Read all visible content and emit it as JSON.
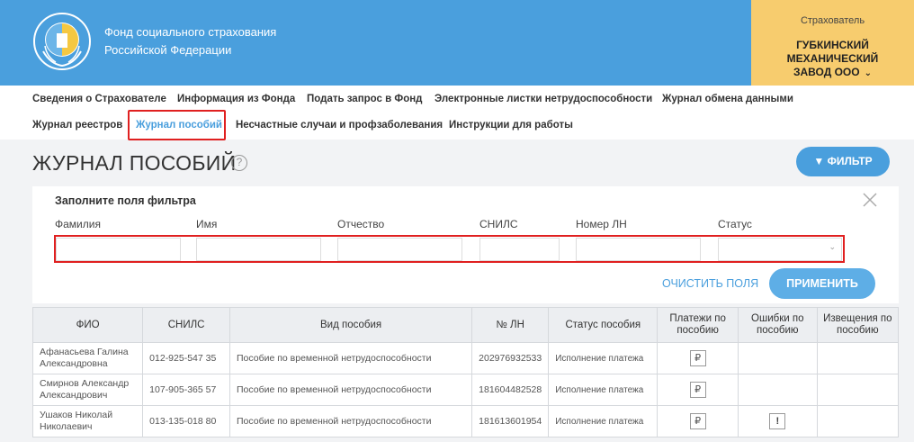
{
  "header": {
    "fund_line1": "Фонд социального страхования",
    "fund_line2": "Российской Федерации",
    "insurer_label": "Страхователь",
    "insurer_line1": "ГУБКИНСКИЙ",
    "insurer_line2": "МЕХАНИЧЕСКИЙ",
    "insurer_line3": "ЗАВОД ООО",
    "brand_color": "#4a9fdd",
    "insurer_color": "#f7cc6e"
  },
  "nav": {
    "items": [
      "Сведения о Страхователе",
      "Информация из Фонда",
      "Подать запрос в Фонд",
      "Электронные листки нетрудоспособности",
      "Журнал обмена данными",
      "Журнал реестров",
      "Журнал пособий",
      "Несчастные случаи и профзаболевания",
      "Инструкции для работы"
    ],
    "active": "Журнал пособий"
  },
  "page": {
    "title": "ЖУРНАЛ ПОСОБИЙ",
    "help": "?",
    "filter_button": "ФИЛЬТР"
  },
  "filter": {
    "heading": "Заполните поля фильтра",
    "labels": [
      "Фамилия",
      "Имя",
      "Отчество",
      "СНИЛС",
      "Номер ЛН",
      "Статус"
    ],
    "clear_label": "ОЧИСТИТЬ ПОЛЯ",
    "apply_label": "ПРИМЕНИТЬ"
  },
  "table": {
    "columns": [
      "ФИО",
      "СНИЛС",
      "Вид пособия",
      "№ ЛН",
      "Статус пособия",
      "Платежи по пособию",
      "Ошибки по пособию",
      "Извещения по пособию"
    ],
    "rows": [
      {
        "name": "Афанасьева Галина Александровна",
        "snils": "012-925-547 35",
        "type": "Пособие по временной нетрудоспособности",
        "ln": "202976932533",
        "status": "Исполнение платежа",
        "payments": "₽",
        "errors": "",
        "notices": ""
      },
      {
        "name": "Смирнов Александр Александрович",
        "snils": "107-905-365 57",
        "type": "Пособие по временной нетрудоспособности",
        "ln": "181604482528",
        "status": "Исполнение платежа",
        "payments": "₽",
        "errors": "",
        "notices": ""
      },
      {
        "name": "Ушаков Николай Николаевич",
        "snils": "013-135-018 80",
        "type": "Пособие по временной нетрудоспособности",
        "ln": "181613601954",
        "status": "Исполнение платежа",
        "payments": "₽",
        "errors": "!",
        "notices": ""
      }
    ]
  }
}
